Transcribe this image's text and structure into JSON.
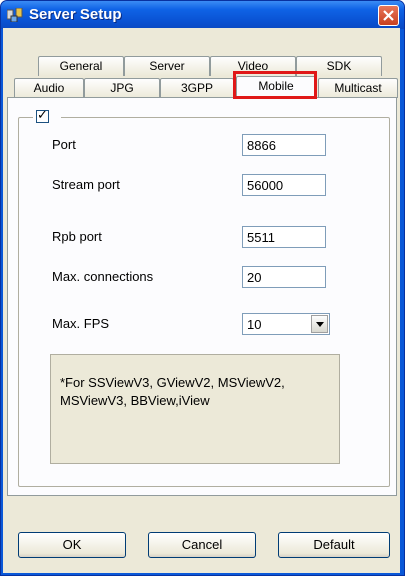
{
  "window": {
    "title": "Server Setup",
    "icon": "app-server-icon",
    "close_icon": "close-icon"
  },
  "tabs": {
    "row1": [
      "General",
      "Server",
      "Video",
      "SDK"
    ],
    "row2": [
      "Audio",
      "JPG",
      "3GPP",
      "Mobile",
      "Multicast"
    ],
    "active": "Mobile"
  },
  "group": {
    "enabled_check": "✓"
  },
  "fields": {
    "port": {
      "label": "Port",
      "value": "8866"
    },
    "stream_port": {
      "label": "Stream port",
      "value": "56000"
    },
    "rpb_port": {
      "label": "Rpb port",
      "value": "5511"
    },
    "max_connections": {
      "label": "Max. connections",
      "value": "20"
    },
    "max_fps": {
      "label": "Max. FPS",
      "value": "10"
    }
  },
  "note": "*For SSViewV3, GViewV2, MSViewV2, MSViewV3, BBView,iView",
  "buttons": {
    "ok": "OK",
    "cancel": "Cancel",
    "default": "Default"
  },
  "colors": {
    "title_bar": "#0a53d4",
    "highlight": "#e01818",
    "face": "#ece9d8"
  }
}
